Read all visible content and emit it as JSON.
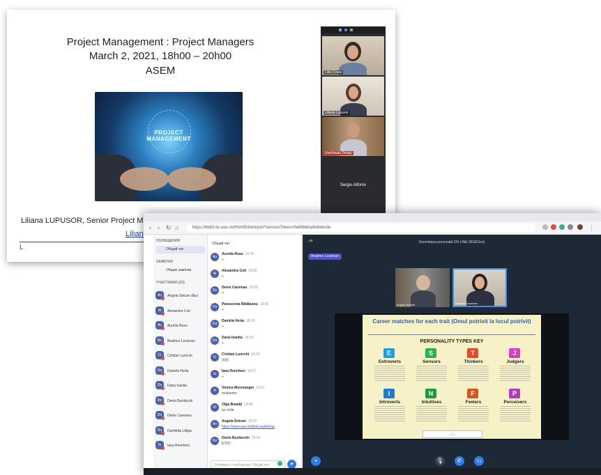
{
  "slide1": {
    "title_line1": "Project Management : Project Managers",
    "title_line2": "March 2, 2021, 18h00 – 20h00",
    "title_line3": "ASEM",
    "image_label": "PROJECT MANAGEMENT",
    "footer_text": "Liliana LUPUSOR, Senior Project Ma",
    "footer_link": "Liliana",
    "zoom": {
      "participants": [
        "Lilia Covas",
        "Liliana Lupusor",
        "Urecheatu Sergiu"
      ],
      "speaker_name": "Sergiu Alforov"
    }
  },
  "browser": {
    "url": "https://bbb3.ds.ase.md/html5client/join?sessionToken=5eb9bbba9a6ebcde"
  },
  "users_panel": {
    "section_messages": "СООБЩЕНИЯ",
    "public_chat": "Общий чат",
    "section_notes": "ЗАМЕТКИ",
    "shared_notes": "Общие заметки",
    "section_users": "УЧАСТНИКИ (22)",
    "users": [
      {
        "initials": "An",
        "name": "Angela Sotcan (Вы)"
      },
      {
        "initials": "Al",
        "name": "Alexandra Coh"
      },
      {
        "initials": "Au",
        "name": "Aurelia Rosu"
      },
      {
        "initials": "Be",
        "name": "Beatrice Loszinan"
      },
      {
        "initials": "Cr",
        "name": "Cristian Luncchi"
      },
      {
        "initials": "Da",
        "name": "Daniela Herta"
      },
      {
        "initials": "Da",
        "name": "Daria Ivanita"
      },
      {
        "initials": "De",
        "name": "Denis Burducchi"
      },
      {
        "initials": "De",
        "name": "Denis Caremau"
      },
      {
        "initials": "Du",
        "name": "Dumitrita Lăliga"
      },
      {
        "initials": "Ia",
        "name": "Iana Rencheci"
      }
    ]
  },
  "chat": {
    "header": "Общий чат",
    "messages": [
      {
        "initials": "Au",
        "name": "Aurelia Rosu",
        "time": "18:06",
        "text": "+"
      },
      {
        "initials": "Al",
        "name": "Alexandra Coh",
        "time": "18:06",
        "text": "+"
      },
      {
        "initials": "De",
        "name": "Denis Caremau",
        "time": "18:06",
        "text": "+"
      },
      {
        "initials": "Pa",
        "name": "Parascovia Rădăsanu",
        "time": "18:06",
        "text": "+"
      },
      {
        "initials": "Da",
        "name": "Daniela Herta",
        "time": "18:06",
        "text": "+"
      },
      {
        "initials": "Da",
        "name": "Daria Ivanita",
        "time": "18:06",
        "text": "+"
      },
      {
        "initials": "Cr",
        "name": "Cristian Luncchi",
        "time": "18:06",
        "text": "))))))"
      },
      {
        "initials": "Ia",
        "name": "Iana Rencheci",
        "time": "18:07",
        "text": "+"
      },
      {
        "initials": "Vi",
        "name": "Viorica Mocreanger",
        "time": "18:07",
        "text": "multumim"
      },
      {
        "initials": "Ol",
        "name": "Olga Boiadji",
        "time": "18:08",
        "text": "se vede"
      },
      {
        "initials": "An",
        "name": "Angela Sotcan",
        "time": "18:09",
        "text": "https://www.ase.md/bolt.audioking",
        "link": true
      },
      {
        "initials": "De",
        "name": "Denis Burducchi",
        "time": "18:09",
        "text": "Ε!ΟΟ"
      }
    ],
    "input_placeholder": "Отправить сообщение Общий чат"
  },
  "meeting": {
    "title": "Domnitiana personală ON LINE (BGEDrm)",
    "presenter_badge": "Beatrice Loszinan",
    "cams": [
      "Angela Sotcan",
      "Beatrice Loszinan"
    ],
    "slide": {
      "title": "Career matches for each trait (Omul potrivit la locul potrivit)",
      "key_title": "PERSONALITY TYPES KEY",
      "traits": [
        {
          "letter": "E",
          "name": "Extroverts",
          "color": "#1f9de0"
        },
        {
          "letter": "S",
          "name": "Sensors",
          "color": "#25b34a"
        },
        {
          "letter": "T",
          "name": "Thinkers",
          "color": "#e84a27"
        },
        {
          "letter": "J",
          "name": "Judgers",
          "color": "#d63fbf"
        },
        {
          "letter": "I",
          "name": "Introverts",
          "color": "#1f7ed0"
        },
        {
          "letter": "N",
          "name": "Intuitives",
          "color": "#1e9a3e"
        },
        {
          "letter": "F",
          "name": "Feelers",
          "color": "#d9541e"
        },
        {
          "letter": "P",
          "name": "Perceivers",
          "color": "#b23bc2"
        }
      ]
    }
  },
  "icons": [
    "back-icon",
    "forward-icon",
    "reload-icon",
    "home-icon",
    "send-icon",
    "plus-icon",
    "mic-icon",
    "phone-icon",
    "camera-icon"
  ]
}
